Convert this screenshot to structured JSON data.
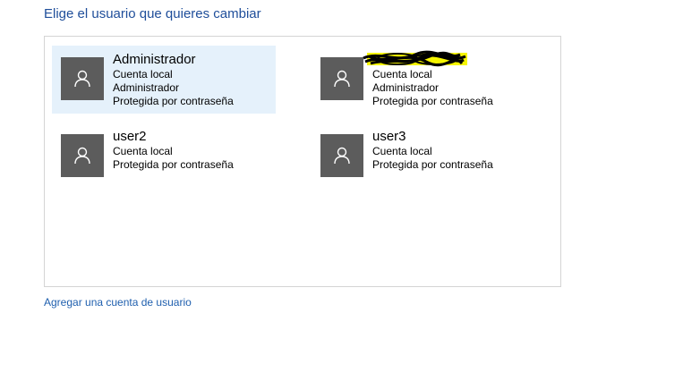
{
  "page": {
    "title": "Elige el usuario que quieres cambiar",
    "add_account_link": "Agregar una cuenta de usuario"
  },
  "accounts": [
    {
      "name": "Administrador",
      "type": "Cuenta local",
      "role": "Administrador",
      "protection": "Protegida por contraseña",
      "selected": true
    },
    {
      "name": "",
      "name_redacted": true,
      "type": "Cuenta local",
      "role": "Administrador",
      "protection": "Protegida por contraseña",
      "selected": false
    },
    {
      "name": "user2",
      "type": "Cuenta local",
      "role": "",
      "protection": "Protegida por contraseña",
      "selected": false
    },
    {
      "name": "user3",
      "type": "Cuenta local",
      "role": "",
      "protection": "Protegida por contraseña",
      "selected": false
    }
  ],
  "icons": {
    "avatar": "user-icon"
  },
  "colors": {
    "title": "#1f4e9a",
    "link": "#1f5fae",
    "selected_background": "#e5f1fb",
    "avatar_background": "#5c5c5c",
    "redaction_highlight": "#f5f500"
  }
}
